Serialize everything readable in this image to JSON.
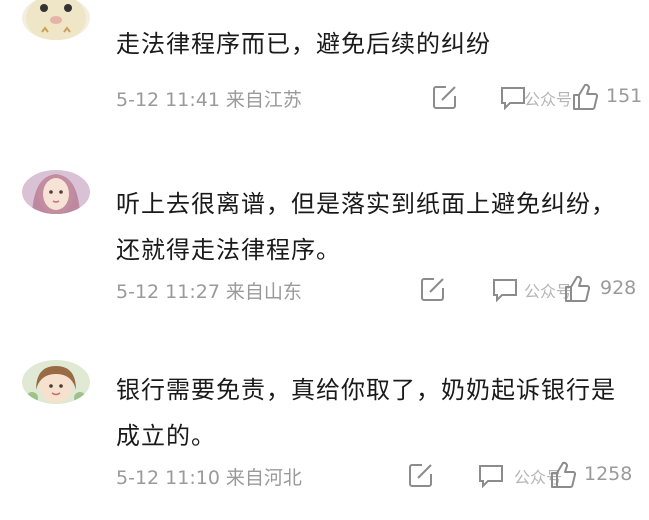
{
  "comments": [
    {
      "text": "走法律程序而已，避免后续的纠纷",
      "date": "5-12 11:41",
      "location": "来自江苏",
      "likes": "151",
      "watermark": "公众号"
    },
    {
      "text": "听上去很离谱，但是落实到纸面上避免纠纷，还就得走法律程序。",
      "date": "5-12 11:27",
      "location": "来自山东",
      "likes": "928",
      "watermark": "公众号"
    },
    {
      "text": "银行需要免责，真给你取了，奶奶起诉银行是成立的。",
      "date": "5-12 11:10",
      "location": "来自河北",
      "likes": "1258",
      "watermark": "公众号"
    }
  ],
  "colors": {
    "text": "#1a1a1a",
    "meta": "#9a9a9a",
    "icon": "#8c8c8c"
  },
  "icons": [
    "edit-share-icon",
    "comment-icon",
    "thumbs-up-icon"
  ]
}
